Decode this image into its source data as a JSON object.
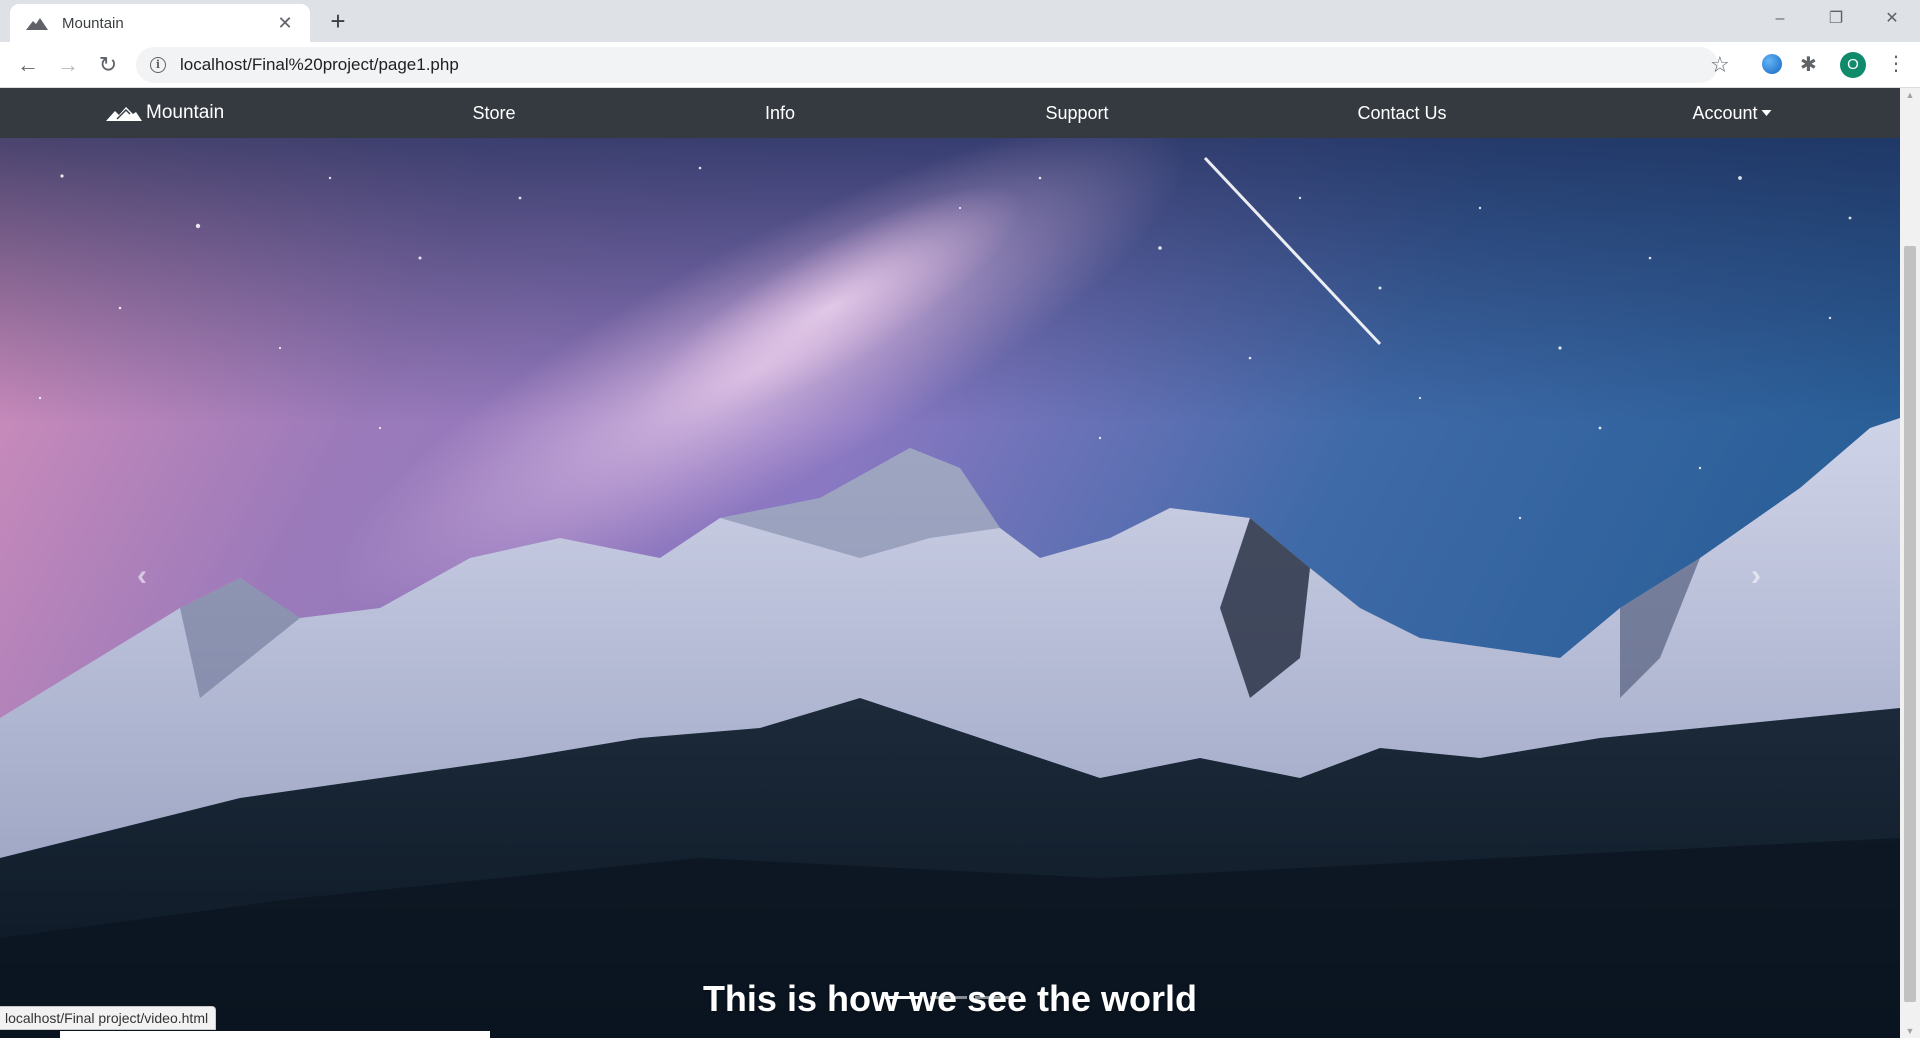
{
  "browser": {
    "tab_title": "Mountain",
    "url": "localhost/Final%20project/page1.php",
    "profile_initial": "O",
    "status_url": "localhost/Final project/video.html"
  },
  "navbar": {
    "brand": "Mountain",
    "links": [
      "Store",
      "Info",
      "Support",
      "Contact Us"
    ],
    "account": "Account"
  },
  "carousel": {
    "caption": "This is how we see the world",
    "slide_count": 3,
    "active_index": 0
  },
  "icons": {
    "back": "arrow-left-icon",
    "forward": "arrow-right-icon",
    "reload": "reload-icon",
    "site_info": "info-icon",
    "bookmark": "star-icon",
    "extension": "globe-icon",
    "extensions_menu": "puzzle-icon",
    "menu": "kebab-menu-icon",
    "carousel_prev": "chevron-left-icon",
    "carousel_next": "chevron-right-icon"
  },
  "colors": {
    "navbar_bg": "#343a40",
    "tabstrip_bg": "#dee1e6",
    "profile_bg": "#0f8a6b"
  }
}
